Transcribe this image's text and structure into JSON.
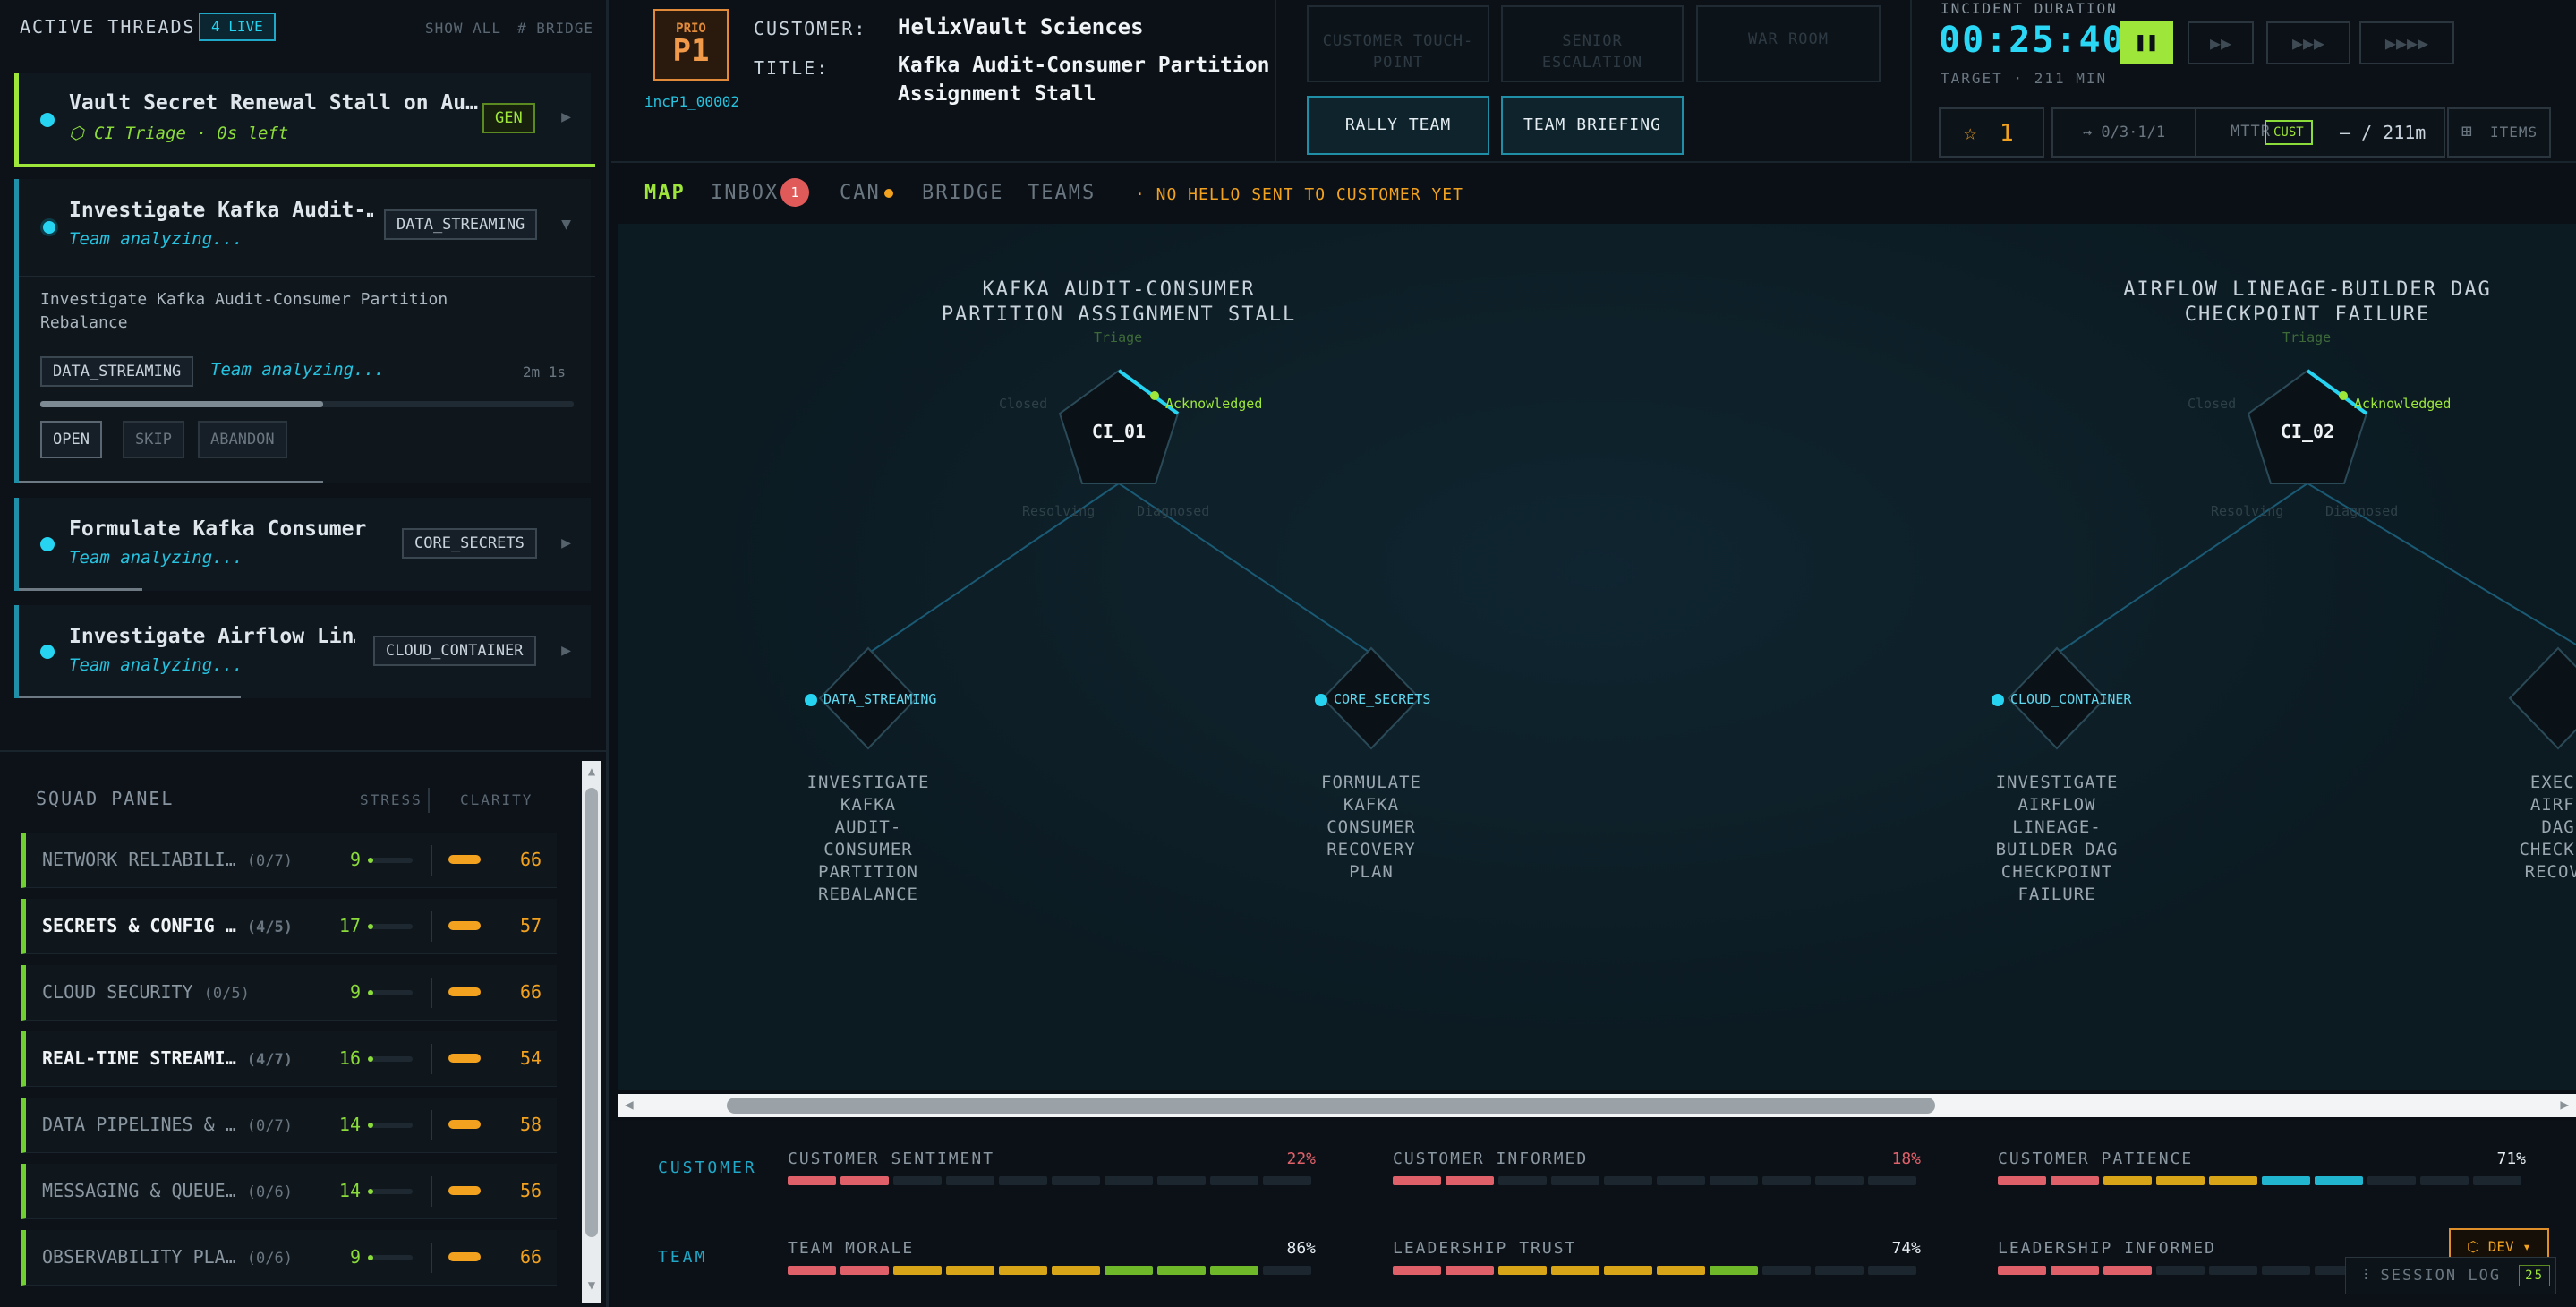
{
  "left_panel": {
    "title": "ACTIVE THREADS",
    "live_badge": "4 LIVE",
    "show_all": "SHOW ALL",
    "bridge": "# BRIDGE"
  },
  "threads": [
    {
      "title": "Vault Secret Renewal Stall on Au…",
      "subtitle": "⬡ CI Triage · 0s left",
      "tag": "GEN"
    },
    {
      "title": "Investigate Kafka Audit-…",
      "subtitle": "Team analyzing...",
      "tag": "DATA_STREAMING",
      "detail": {
        "description_1": "Investigate Kafka Audit-Consumer Partition",
        "description_2": "Rebalance",
        "tag": "DATA_STREAMING",
        "status": "Team analyzing...",
        "time": "2m 1s",
        "progress": 0.53,
        "buttons": [
          "OPEN",
          "SKIP",
          "ABANDON"
        ]
      }
    },
    {
      "title": "Formulate Kafka Consumer …",
      "subtitle": "Team analyzing...",
      "tag": "CORE_SECRETS"
    },
    {
      "title": "Investigate Airflow Lin…",
      "subtitle": "Team analyzing...",
      "tag": "CLOUD_CONTAINER"
    }
  ],
  "squad": {
    "title": "SQUAD PANEL",
    "col_stress": "STRESS",
    "col_clarity": "CLARITY",
    "rows": [
      {
        "name": "NETWORK RELIABILI…",
        "count": "(0/7)",
        "stress": "9",
        "clarity": "66"
      },
      {
        "name": "SECRETS & CONFIG …",
        "count": "(4/5)",
        "stress": "17",
        "clarity": "57"
      },
      {
        "name": "CLOUD SECURITY",
        "count": "(0/5)",
        "stress": "9",
        "clarity": "66"
      },
      {
        "name": "REAL-TIME STREAMI…",
        "count": "(4/7)",
        "stress": "16",
        "clarity": "54"
      },
      {
        "name": "DATA PIPELINES & …",
        "count": "(0/7)",
        "stress": "14",
        "clarity": "58"
      },
      {
        "name": "MESSAGING & QUEUE…",
        "count": "(0/6)",
        "stress": "14",
        "clarity": "56"
      },
      {
        "name": "OBSERVABILITY PLA…",
        "count": "(0/6)",
        "stress": "9",
        "clarity": "66"
      }
    ]
  },
  "header": {
    "prio_label": "PRIO",
    "prio": "P1",
    "incident_id": "incP1_00002",
    "customer_label": "CUSTOMER:",
    "customer": "HelixVault Sciences",
    "title_label": "TITLE:",
    "title_1": "Kafka Audit-Consumer Partition",
    "title_2": "Assignment Stall",
    "buttons_disabled": [
      "CUSTOMER TOUCH-\nPOINT",
      "SENIOR\nESCALATION",
      "WAR ROOM"
    ],
    "rally": "RALLY TEAM",
    "briefing": "TEAM BRIEFING",
    "duration_label": "INCIDENT DURATION",
    "timer": "00:25:40",
    "target": "TARGET · 211 MIN",
    "speed": [
      "▶▶",
      "▶▶▶",
      "▶▶▶▶"
    ],
    "stars": "1",
    "ratio": "⇝ 0/3·1/1",
    "mttr": "MTTR",
    "cust": "CUST",
    "mttr_val": "— / 211m",
    "items": "ITEMS"
  },
  "tabs": {
    "map": "MAP",
    "inbox": "INBOX",
    "inbox_count": "1",
    "can": "CAN",
    "bridge": "BRIDGE",
    "teams": "TEAMS",
    "warning": "· NO HELLO SENT TO CUSTOMER YET"
  },
  "map": {
    "incidents": [
      {
        "title_1": "KAFKA AUDIT-CONSUMER",
        "title_2": "PARTITION ASSIGNMENT STALL",
        "id": "CI_01",
        "stages": {
          "top": "Triage",
          "right": "Acknowledged",
          "left": "Closed",
          "bl": "Resolving",
          "br": "Diagnosed"
        }
      },
      {
        "title_1": "AIRFLOW LINEAGE-BUILDER DAG",
        "title_2": "CHECKPOINT FAILURE",
        "id": "CI_02",
        "stages": {
          "top": "Triage",
          "right": "Acknowledged",
          "left": "Closed",
          "bl": "Resolving",
          "br": "Diagnosed"
        }
      }
    ],
    "tasks": [
      {
        "tag": "DATA_STREAMING",
        "lines": [
          "INVESTIGATE",
          "KAFKA",
          "AUDIT-",
          "CONSUMER",
          "PARTITION",
          "REBALANCE"
        ]
      },
      {
        "tag": "CORE_SECRETS",
        "lines": [
          "FORMULATE",
          "KAFKA",
          "CONSUMER",
          "RECOVERY",
          "PLAN"
        ]
      },
      {
        "tag": "CLOUD_CONTAINER",
        "lines": [
          "INVESTIGATE",
          "AIRFLOW",
          "LINEAGE-",
          "BUILDER DAG",
          "CHECKPOINT",
          "FAILURE"
        ]
      },
      {
        "tag": "",
        "lines": [
          "EXECU",
          "AIRFL",
          "DAG",
          "CHECKPO",
          "RECOVE"
        ]
      }
    ]
  },
  "metrics": {
    "customer_group": "CUSTOMER",
    "team_group": "TEAM",
    "customer": [
      {
        "label": "CUSTOMER SENTIMENT",
        "pct": "22%",
        "value": 0.22
      },
      {
        "label": "CUSTOMER INFORMED",
        "pct": "18%",
        "value": 0.18
      },
      {
        "label": "CUSTOMER PATIENCE",
        "pct": "71%",
        "value": 0.71
      }
    ],
    "team": [
      {
        "label": "TEAM MORALE",
        "pct": "86%",
        "value": 0.86
      },
      {
        "label": "LEADERSHIP TRUST",
        "pct": "74%",
        "value": 0.74
      },
      {
        "label": "LEADERSHIP INFORMED",
        "pct": "",
        "value": 0.3
      }
    ]
  },
  "footer": {
    "dev": "⬡ DEV ▾",
    "session_log": "⫶ SESSION LOG",
    "session_count": "25"
  },
  "colors": {
    "accent": "#26d3f0",
    "lime": "#9ee73a",
    "amber": "#f3a21f",
    "red": "#e0606a"
  }
}
